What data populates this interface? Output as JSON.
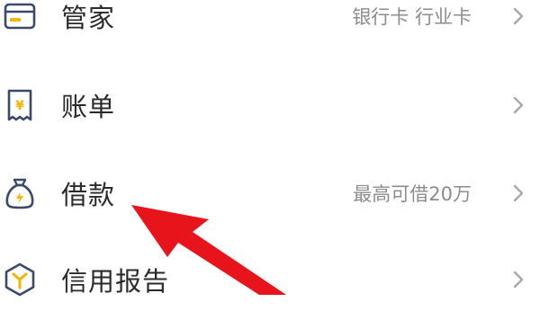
{
  "menu": {
    "items": [
      {
        "icon": "card-icon",
        "label": "管家",
        "detail": "银行卡 行业卡"
      },
      {
        "icon": "bill-icon",
        "label": "账单",
        "detail": ""
      },
      {
        "icon": "money-bag-icon",
        "label": "借款",
        "detail": "最高可借20万"
      },
      {
        "icon": "credit-report-icon",
        "label": "信用报告",
        "detail": ""
      }
    ]
  },
  "colors": {
    "icon_stroke": "#3b4a6b",
    "accent_yellow": "#f5b400",
    "arrow_red": "#e8141b",
    "label_text": "#2a2a2a",
    "detail_text": "#8c8c8c",
    "chevron": "#a8a8a8"
  }
}
